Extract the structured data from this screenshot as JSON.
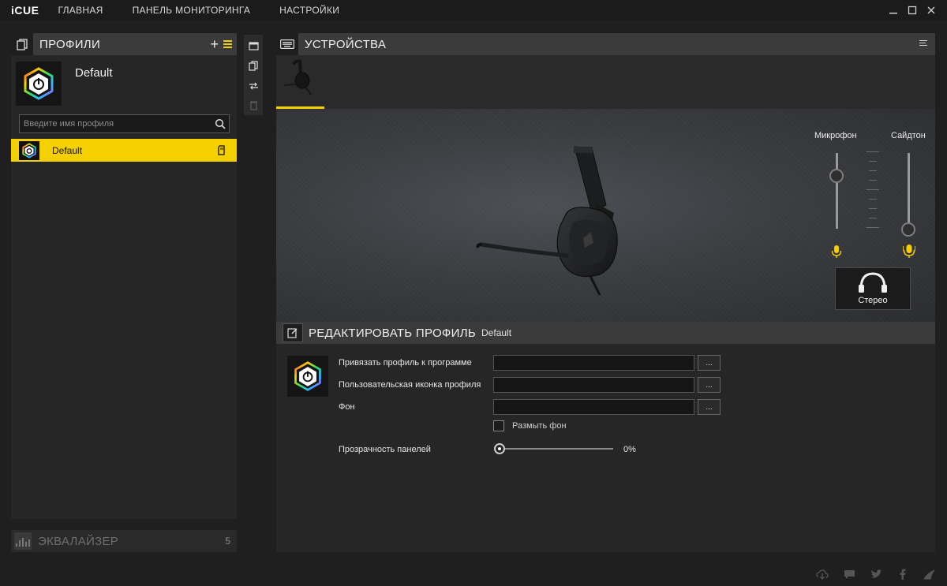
{
  "app": {
    "logo": "iCUE",
    "nav": [
      "ГЛАВНАЯ",
      "ПАНЕЛЬ МОНИТОРИНГА",
      "НАСТРОЙКИ"
    ],
    "window_controls": [
      "minimize-icon",
      "maximize-icon",
      "close-icon"
    ]
  },
  "profiles": {
    "title": "ПРОФИЛИ",
    "current_name": "Default",
    "search_placeholder": "Введите имя профиля",
    "items": [
      {
        "label": "Default"
      }
    ]
  },
  "equalizer": {
    "title": "ЭКВАЛАЙЗЕР",
    "count": "5"
  },
  "devices": {
    "title": "УСТРОЙСТВА",
    "mic_label": "Микрофон",
    "sidetone_label": "Сайдтон",
    "mic_level": 0.7,
    "sidetone_level": 0.0,
    "stereo_label": "Стерео"
  },
  "edit_profile": {
    "title": "РЕДАКТИРОВАТЬ ПРОФИЛЬ",
    "profile_name": "Default",
    "bind_label": "Привязать профиль к программе",
    "icon_label": "Пользовательская иконка профиля",
    "background_label": "Фон",
    "dots": "...",
    "blur_label": "Размыть фон",
    "opacity_label": "Прозрачность панелей",
    "opacity_value": "0%"
  },
  "colors": {
    "accent": "#f5d000",
    "panel": "#262626",
    "header": "#3b3b3b"
  },
  "footer_icons": [
    "download-icon",
    "chat-icon",
    "twitter-icon",
    "facebook-icon",
    "corsair-icon"
  ]
}
